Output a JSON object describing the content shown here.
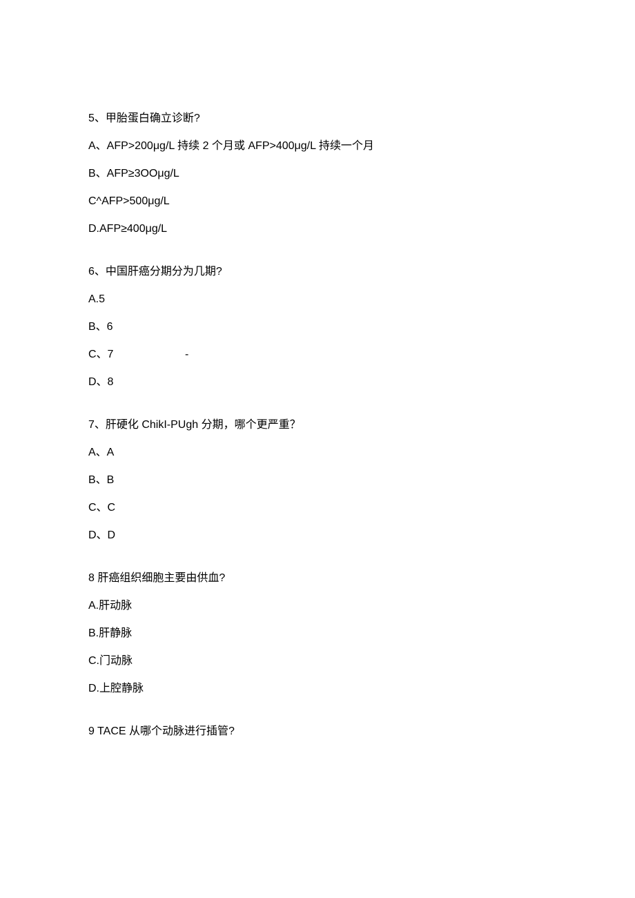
{
  "q5": {
    "title": "5、甲胎蛋白确立诊断?",
    "optA": "A、AFP>200μg/L 持续 2 个月或 AFP>400μg/L 持续一个月",
    "optB": "B、AFP≥3OOμg/L",
    "optC": "C^AFP>500μg/L",
    "optD": "D.AFP≥400μg/L"
  },
  "q6": {
    "title": "6、中国肝癌分期分为几期?",
    "optA": "A.5",
    "optB": "B、6",
    "optC": "C、7",
    "optC_dash": "-",
    "optD": "D、8"
  },
  "q7": {
    "title": "7、肝硬化 ChikI-PUgh 分期，哪个更严重？",
    "optA": "A、A",
    "optB": "B、B",
    "optC": "C、C",
    "optD": "D、D"
  },
  "q8": {
    "title": "8 肝癌组织细胞主要由供血?",
    "optA": "A.肝动脉",
    "optB": "B.肝静脉",
    "optC": "C.门动脉",
    "optD": "D.上腔静脉"
  },
  "q9": {
    "title": "9   TACE 从哪个动脉进行插管?"
  }
}
